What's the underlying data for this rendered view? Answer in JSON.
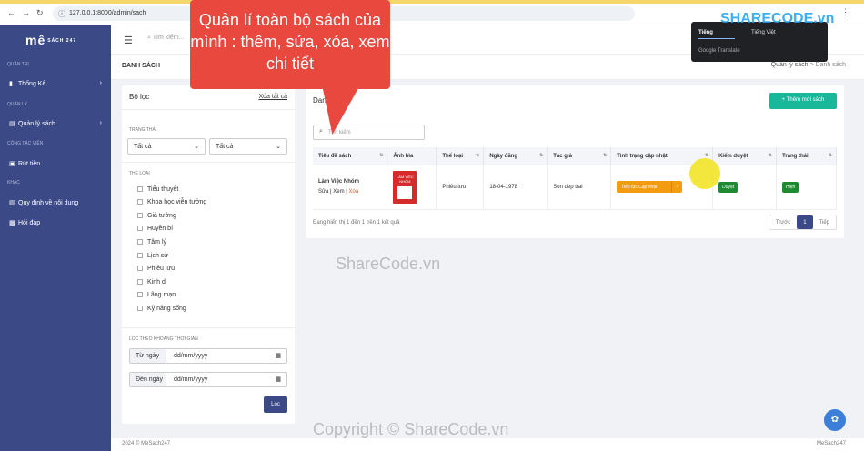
{
  "browser": {
    "url": "127.0.0.1:8000/admin/sach"
  },
  "sidebar": {
    "logo": "mê",
    "logo_small": "SÁCH 247",
    "sections": {
      "quan_tri": "QUẢN TRỊ",
      "quan_ly": "QUẢN LÝ",
      "cong_tac_vien": "CỘNG TÁC VIÊN",
      "khac": "KHÁC"
    },
    "items": {
      "thong_ke": "Thống Kê",
      "quan_ly_sach": "Quản lý sách",
      "rut_tien": "Rút tiền",
      "quy_dinh": "Quy định về nội dung",
      "hoi_dap": "Hỏi đáp"
    }
  },
  "header": {
    "search_placeholder": "Tìm kiếm..."
  },
  "page": {
    "title": "DANH SÁCH",
    "breadcrumb_1": "Quản lý sách",
    "breadcrumb_sep": ">",
    "breadcrumb_2": "Danh sách"
  },
  "filter": {
    "title": "Bộ lọc",
    "clear_all": "Xóa tất cả",
    "status_label": "TRẠNG THÁI",
    "select_1": "Tất cả",
    "select_2": "Tất cả",
    "genre_label": "THỂ LOẠI",
    "genres": [
      "Tiểu thuyết",
      "Khoa học viễn tưởng",
      "Giả tưởng",
      "Huyền bí",
      "Tâm lý",
      "Lịch sử",
      "Phiêu lưu",
      "Kinh dị",
      "Lãng mạn",
      "Kỹ năng sống"
    ],
    "time_label": "LỌC THEO KHOẢNG THỜI GIAN",
    "from_label": "Từ ngày",
    "to_label": "Đến ngày",
    "date_placeholder": "dd/mm/yyyy",
    "submit": "Lọc"
  },
  "list": {
    "title": "Danh sách",
    "add_button": "+ Thêm mới sách",
    "search_placeholder": "Tìm kiếm",
    "columns": [
      "Tiêu đề sách",
      "Ảnh bìa",
      "Thể loại",
      "Ngày đăng",
      "Tác giả",
      "Tình trạng cập nhật",
      "Kiểm duyệt",
      "Trạng thái"
    ],
    "rows": [
      {
        "title": "Làm Việc Nhóm",
        "edit": "Sửa",
        "sep1": " | ",
        "view": "Xem",
        "sep2": " | ",
        "delete": "Xóa",
        "cover_text": "LÀM VIỆC NHÓM",
        "genre": "Phiêu lưu",
        "date": "18-04-1978",
        "author": "Son dep trai",
        "update_status": "Tiếp tục Cập nhật",
        "moderation": "Duyệt",
        "state": "Hiện"
      }
    ],
    "info": "Đang hiển thị 1 đến 1 trên 1 kết quả",
    "pager": {
      "prev": "Trước",
      "current": "1",
      "next": "Tiếp"
    }
  },
  "footer": {
    "left": "2024 © MeSach247",
    "right": "MeSach247"
  },
  "callout": {
    "text": "Quản lí toàn bộ sách của mình : thêm, sửa, xóa, xem chi tiết"
  },
  "translate_popup": {
    "tab_1": "Tiếng",
    "tab_2": "Tiếng Việt",
    "footer": "Google Translate"
  },
  "watermarks": {
    "logo": "SHARECODE.vn",
    "center": "ShareCode.vn",
    "bottom": "Copyright © ShareCode.vn"
  },
  "colors": {
    "sidebar": "#3b4a87",
    "accent_green": "#19b89b",
    "callout": "#e9483f",
    "warning": "#f39c12",
    "success": "#1e8a32"
  }
}
